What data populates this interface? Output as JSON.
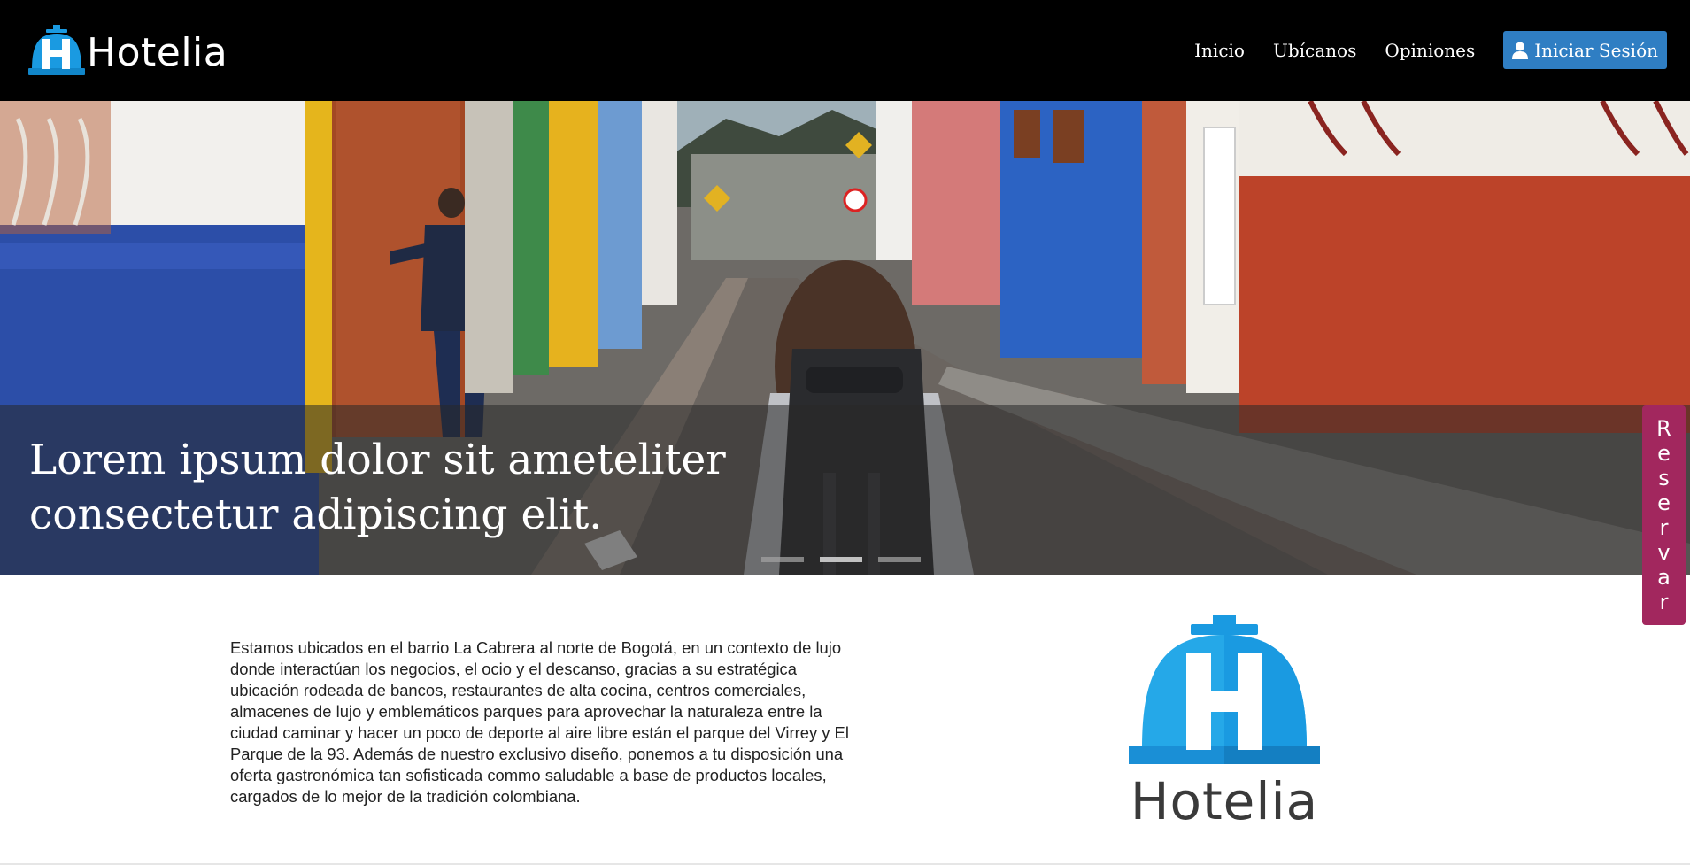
{
  "brand": {
    "name": "Hotelia",
    "logo_letter": "H",
    "color": "#1a9ae1"
  },
  "nav": {
    "links": [
      "Inicio",
      "Ubícanos",
      "Opiniones"
    ],
    "login_label": "Iniciar Sesión",
    "login_icon": "user-icon",
    "login_color": "#2f7ec3"
  },
  "hero": {
    "caption": "Lorem ipsum dolor sit ameteliter consectetur adipiscing elit.",
    "indicators": 3,
    "active_indicator": 2
  },
  "side_tab": {
    "label": "Reservar",
    "color": "#a2275e"
  },
  "about": {
    "text": "Estamos ubicados en el barrio La Cabrera al norte de Bogotá, en un contexto de lujo donde interactúan los negocios, el ocio y el descanso, gracias a su estratégica ubicación rodeada de bancos, restaurantes de alta cocina, centros comerciales, almacenes de lujo y emblemáticos parques para aprovechar la naturaleza entre la ciudad caminar y hacer un poco de deporte al aire libre están el parque del Virrey y El Parque de la 93. Además de nuestro exclusivo diseño, ponemos a tu disposición una oferta gastronómica tan sofisticada commo saludable a base de productos locales, cargados de lo mejor de la tradición colombiana."
  },
  "logo_large": {
    "name": "Hotelia",
    "color": "#1a9ae1",
    "text_color": "#3a3a3a"
  }
}
